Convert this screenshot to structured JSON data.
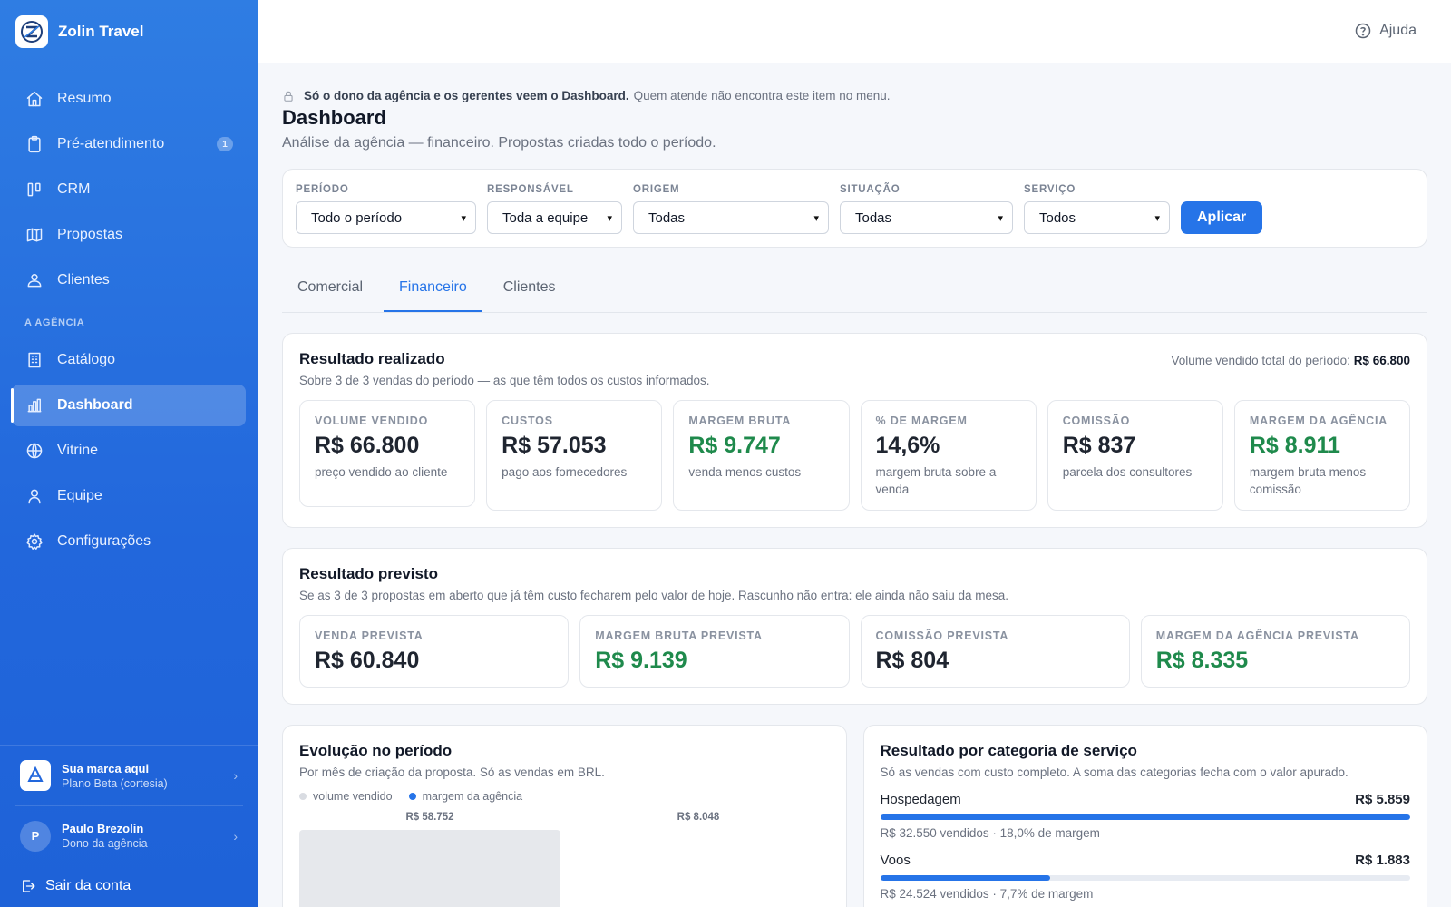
{
  "brand": {
    "name": "Zolin Travel"
  },
  "sidebar": {
    "items": [
      {
        "label": "Resumo",
        "icon": "home-icon"
      },
      {
        "label": "Pré-atendimento",
        "icon": "clipboard-icon",
        "badge": "1"
      },
      {
        "label": "CRM",
        "icon": "kanban-icon"
      },
      {
        "label": "Propostas",
        "icon": "map-icon"
      },
      {
        "label": "Clientes",
        "icon": "users-icon"
      }
    ],
    "section_label": "A AGÊNCIA",
    "agency_items": [
      {
        "label": "Catálogo",
        "icon": "building-icon"
      },
      {
        "label": "Dashboard",
        "icon": "bar-chart-icon",
        "active": true
      },
      {
        "label": "Vitrine",
        "icon": "globe-icon"
      },
      {
        "label": "Equipe",
        "icon": "user-icon"
      },
      {
        "label": "Configurações",
        "icon": "gear-icon"
      }
    ],
    "brand_card": {
      "title": "Sua marca aqui",
      "subtitle": "Plano Beta (cortesia)"
    },
    "user": {
      "initial": "P",
      "name": "Paulo Brezolin",
      "role": "Dono da agência"
    },
    "logout_label": "Sair da conta"
  },
  "topbar": {
    "help_label": "Ajuda"
  },
  "notice": {
    "bold": "Só o dono da agência e os gerentes veem o Dashboard.",
    "text": "Quem atende não encontra este item no menu."
  },
  "page": {
    "title": "Dashboard",
    "subtitle": "Análise da agência — financeiro. Propostas criadas todo o período."
  },
  "filters": {
    "periodo": {
      "label": "PERÍODO",
      "value": "Todo o período"
    },
    "responsavel": {
      "label": "RESPONSÁVEL",
      "value": "Toda a equipe"
    },
    "origem": {
      "label": "ORIGEM",
      "value": "Todas"
    },
    "situacao": {
      "label": "SITUAÇÃO",
      "value": "Todas"
    },
    "servico": {
      "label": "SERVIÇO",
      "value": "Todos"
    },
    "apply_label": "Aplicar"
  },
  "tabs": [
    {
      "label": "Comercial"
    },
    {
      "label": "Financeiro",
      "active": true
    },
    {
      "label": "Clientes"
    }
  ],
  "realizado": {
    "title": "Resultado realizado",
    "subtitle": "Sobre 3 de 3 vendas do período — as que têm todos os custos informados.",
    "total_label": "Volume vendido total do período:",
    "total_value": "R$ 66.800",
    "kpis": [
      {
        "label": "VOLUME VENDIDO",
        "value": "R$ 66.800",
        "desc": "preço vendido ao cliente",
        "green": false
      },
      {
        "label": "CUSTOS",
        "value": "R$ 57.053",
        "desc": "pago aos fornecedores",
        "green": false
      },
      {
        "label": "MARGEM BRUTA",
        "value": "R$ 9.747",
        "desc": "venda menos custos",
        "green": true
      },
      {
        "label": "% DE MARGEM",
        "value": "14,6%",
        "desc": "margem bruta sobre a venda",
        "green": false
      },
      {
        "label": "COMISSÃO",
        "value": "R$ 837",
        "desc": "parcela dos consultores",
        "green": false
      },
      {
        "label": "MARGEM DA AGÊNCIA",
        "value": "R$ 8.911",
        "desc": "margem bruta menos comissão",
        "green": true
      }
    ]
  },
  "previsto": {
    "title": "Resultado previsto",
    "subtitle": "Se as 3 de 3 propostas em aberto que já têm custo fecharem pelo valor de hoje. Rascunho não entra: ele ainda não saiu da mesa.",
    "kpis": [
      {
        "label": "VENDA PREVISTA",
        "value": "R$ 60.840",
        "green": false
      },
      {
        "label": "MARGEM BRUTA PREVISTA",
        "value": "R$ 9.139",
        "green": true
      },
      {
        "label": "COMISSÃO PREVISTA",
        "value": "R$ 804",
        "green": false
      },
      {
        "label": "MARGEM DA AGÊNCIA PREVISTA",
        "value": "R$ 8.335",
        "green": true
      }
    ]
  },
  "evolucao": {
    "title": "Evolução no período",
    "subtitle": "Por mês de criação da proposta. Só as vendas em BRL.",
    "legend": [
      {
        "label": "volume vendido",
        "color": "#d9dce2"
      },
      {
        "label": "margem da agência",
        "color": "#2674e8"
      }
    ],
    "bar_labels": [
      "R$ 58.752",
      "R$ 8.048"
    ]
  },
  "categorias": {
    "title": "Resultado por categoria de serviço",
    "subtitle": "Só as vendas com custo completo. A soma das categorias fecha com o valor apurado.",
    "items": [
      {
        "name": "Hospedagem",
        "value": "R$ 5.859",
        "desc": "R$ 32.550 vendidos · 18,0% de margem",
        "fraction": 1.0
      },
      {
        "name": "Voos",
        "value": "R$ 1.883",
        "desc": "R$ 24.524 vendidos · 7,7% de margem",
        "fraction": 0.32
      }
    ]
  },
  "colors": {
    "accent": "#2674e8",
    "green": "#1f8a4c",
    "sidebar": "#2267dc"
  }
}
